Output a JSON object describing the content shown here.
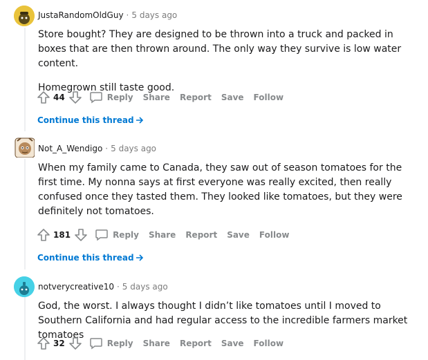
{
  "comments": [
    {
      "author": "JustaRandomOldGuy",
      "separator": "·",
      "time": "5 days ago",
      "paragraphs": [
        "Store bought? They are designed to be thrown into a truck and packed in boxes that are then thrown around. The only way they survive is low water content.",
        "Homegrown still taste good."
      ],
      "votes": "44",
      "continue": "Continue this thread"
    },
    {
      "author": "Not_A_Wendigo",
      "separator": "·",
      "time": "5 days ago",
      "paragraphs": [
        "When my family came to Canada, they saw out of season tomatoes for the first time. My nonna says at first everyone was really excited, then really confused once they tasted them. They looked like tomatoes, but they were definitely not tomatoes."
      ],
      "votes": "181",
      "continue": "Continue this thread"
    },
    {
      "author": "notverycreative10",
      "separator": "·",
      "time": "5 days ago",
      "paragraphs": [
        "God, the worst. I always thought I didn’t like tomatoes until I moved to Southern California and had regular access to the incredible farmers market tomatoes"
      ],
      "votes": "32"
    }
  ],
  "actions": {
    "reply": "Reply",
    "share": "Share",
    "report": "Report",
    "save": "Save",
    "follow": "Follow"
  },
  "icons": {
    "upvote": "upvote-arrow-icon",
    "downvote": "downvote-arrow-icon",
    "reply": "speech-bubble-icon",
    "continue": "arrow-right-icon"
  },
  "colors": {
    "link": "#0079d3",
    "muted": "#878a8c",
    "text": "#1a1a1b"
  }
}
